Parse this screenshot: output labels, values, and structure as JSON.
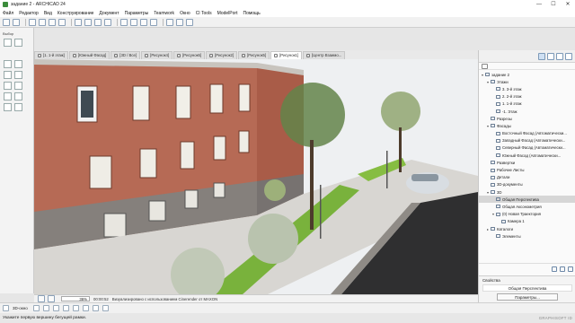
{
  "window": {
    "title": "задание 2 - ARCHICAD 24",
    "controls": [
      "—",
      "☐",
      "✕"
    ]
  },
  "menu": [
    "Файл",
    "Редактор",
    "Вид",
    "Конструирование",
    "Документ",
    "Параметры",
    "Teamwork",
    "Окно",
    "CI Tools",
    "ModelPort",
    "Помощь"
  ],
  "tabs": [
    {
      "label": "[1. 1-й этаж]",
      "active": false
    },
    {
      "label": "[Южный Фасад]",
      "active": false
    },
    {
      "label": "[3D / Все]",
      "active": false
    },
    {
      "label": "[Рисунок4]",
      "active": false
    },
    {
      "label": "[Рисунок6]",
      "active": false
    },
    {
      "label": "[Рисунок2]",
      "active": false
    },
    {
      "label": "[Рисунок5]",
      "active": false
    },
    {
      "label": "[Рисунок1]",
      "active": true
    },
    {
      "label": "[Центр Взаимо...",
      "active": false
    }
  ],
  "toolbox": {
    "label": "Выбор"
  },
  "navigator": {
    "tree": [
      {
        "label": "задание 2",
        "expander": "▾",
        "indent": 0,
        "selected": false
      },
      {
        "label": "Этажи",
        "expander": "▾",
        "indent": 1,
        "selected": false
      },
      {
        "label": "3. 3-й этаж",
        "expander": "",
        "indent": 2,
        "selected": false
      },
      {
        "label": "2. 2-й этаж",
        "expander": "",
        "indent": 2,
        "selected": false
      },
      {
        "label": "1. 1-й этаж",
        "expander": "",
        "indent": 2,
        "selected": false
      },
      {
        "label": "-1. Этаж",
        "expander": "",
        "indent": 2,
        "selected": false
      },
      {
        "label": "Разрезы",
        "expander": "",
        "indent": 1,
        "selected": false
      },
      {
        "label": "Фасады",
        "expander": "▾",
        "indent": 1,
        "selected": false
      },
      {
        "label": "Восточный Фасад (Автоматически...",
        "expander": "",
        "indent": 2,
        "selected": false
      },
      {
        "label": "Западный Фасад (Автоматически...",
        "expander": "",
        "indent": 2,
        "selected": false
      },
      {
        "label": "Северный Фасад (Автоматически...",
        "expander": "",
        "indent": 2,
        "selected": false
      },
      {
        "label": "Южный Фасад (Автоматически...",
        "expander": "",
        "indent": 2,
        "selected": false
      },
      {
        "label": "Развертки",
        "expander": "",
        "indent": 1,
        "selected": false
      },
      {
        "label": "Рабочие Листы",
        "expander": "",
        "indent": 1,
        "selected": false
      },
      {
        "label": "Детали",
        "expander": "",
        "indent": 1,
        "selected": false
      },
      {
        "label": "3D-документы",
        "expander": "",
        "indent": 1,
        "selected": false
      },
      {
        "label": "3D",
        "expander": "▾",
        "indent": 1,
        "selected": false
      },
      {
        "label": "Общая Перспектива",
        "expander": "",
        "indent": 2,
        "selected": true
      },
      {
        "label": "Общая Аксонометрия",
        "expander": "",
        "indent": 2,
        "selected": false
      },
      {
        "label": "(0) Новая Траектория",
        "expander": "▾",
        "indent": 2,
        "selected": false
      },
      {
        "label": "Камера 1",
        "expander": "",
        "indent": 3,
        "selected": false
      },
      {
        "label": "Каталоги",
        "expander": "▸",
        "indent": 1,
        "selected": false
      },
      {
        "label": "Элементы",
        "expander": "",
        "indent": 2,
        "selected": false
      }
    ],
    "properties": {
      "header": "Свойства",
      "value": "Общая Перспектива",
      "button": "Параметры..."
    }
  },
  "statusbar": {
    "zoom": "36%",
    "time": "00:00:52",
    "message": "Визуализировано с использованием Cinerender от MAXON"
  },
  "bottom_toolbar": {
    "view_label": "3D-окно"
  },
  "hint": {
    "text": "Укажите первую вершину бегущей рамки.",
    "brand": "GRAPHISOFT ID"
  }
}
